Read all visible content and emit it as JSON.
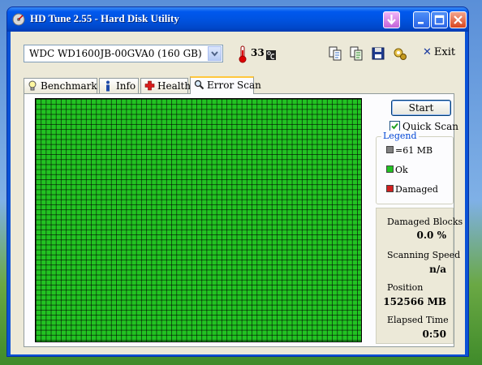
{
  "window": {
    "title": "HD Tune 2.55 - Hard Disk Utility"
  },
  "toolbar": {
    "drive": "WDC WD1600JB-00GVA0 (160 GB)",
    "temperature": "33",
    "exit_label": "Exit"
  },
  "tabs": [
    {
      "label": "Benchmark",
      "icon": "lightbulb-icon"
    },
    {
      "label": "Info",
      "icon": "info-icon"
    },
    {
      "label": "Health",
      "icon": "health-cross-icon"
    },
    {
      "label": "Error Scan",
      "icon": "magnifier-icon"
    }
  ],
  "error_scan": {
    "start_label": "Start",
    "quick_scan_label": "Quick Scan",
    "quick_scan_checked": true,
    "legend": {
      "title": "Legend",
      "block_size": "=61 MB",
      "ok": "Ok",
      "damaged": "Damaged"
    },
    "stats": {
      "damaged_blocks_label": "Damaged Blocks",
      "damaged_blocks_value": "0.0 %",
      "scanning_speed_label": "Scanning Speed",
      "scanning_speed_value": "n/a",
      "position_label": "Position",
      "position_value": "152566 MB",
      "elapsed_time_label": "Elapsed Time",
      "elapsed_time_value": "0:50"
    }
  },
  "colors": {
    "block_ok": "#22c322",
    "block_damaged": "#d21f1f",
    "block_unit": "#808080",
    "titlebar": "#0053e0"
  }
}
